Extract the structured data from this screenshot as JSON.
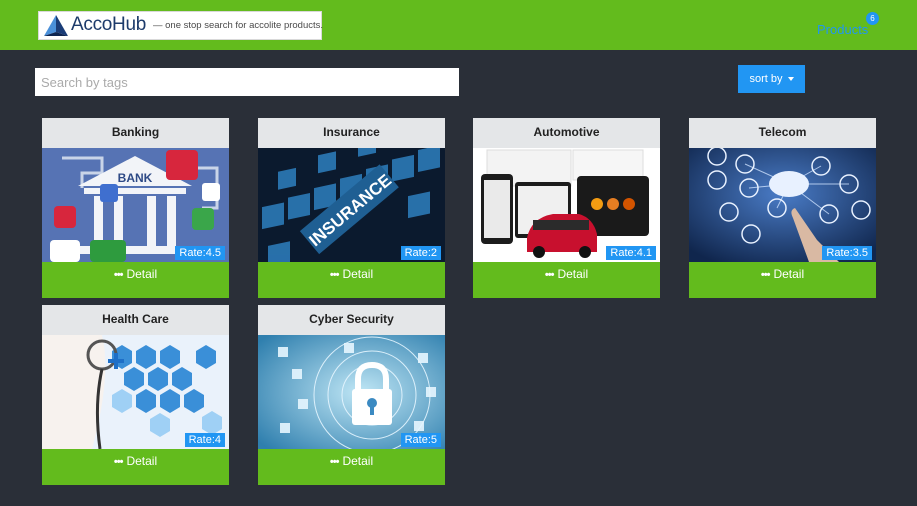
{
  "header": {
    "logo_name": "AccoHub",
    "logo_tagline": "— one stop search for accolite products.",
    "products_label": "Products",
    "products_count": "6",
    "accent_color": "#63bb1d"
  },
  "search": {
    "placeholder": "Search by tags",
    "value": ""
  },
  "sort": {
    "label": "sort by"
  },
  "detail_label": "Detail",
  "cards": [
    {
      "title": "Banking",
      "rate": "Rate:4.5",
      "image": "bank-illustration"
    },
    {
      "title": "Insurance",
      "rate": "Rate:2",
      "image": "insurance-tiles"
    },
    {
      "title": "Automotive",
      "rate": "Rate:4.1",
      "image": "car-dashboard"
    },
    {
      "title": "Telecom",
      "rate": "Rate:3.5",
      "image": "cloud-network"
    },
    {
      "title": "Health Care",
      "rate": "Rate:4",
      "image": "stethoscope-hexagons"
    },
    {
      "title": "Cyber Security",
      "rate": "Rate:5",
      "image": "padlock-circuit"
    }
  ]
}
